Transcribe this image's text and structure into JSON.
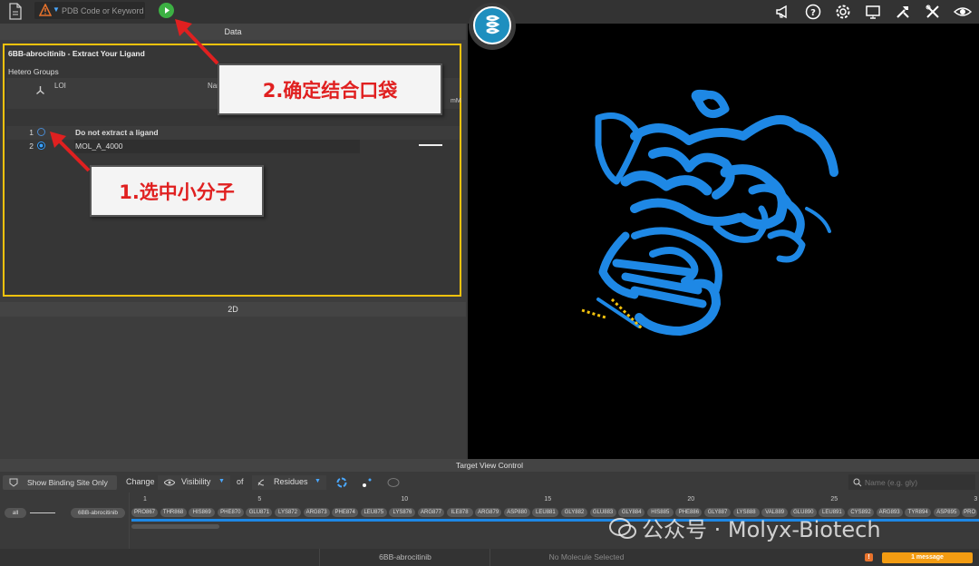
{
  "toolbar": {
    "search_placeholder": "PDB Code or Keyword",
    "icons": [
      "file-icon",
      "warning-icon",
      "play-icon",
      "megaphone-icon",
      "help-icon",
      "settings-icon",
      "monitor-icon",
      "build-tools-icon",
      "tools-icon",
      "eye-icon"
    ]
  },
  "data_panel": {
    "header": "Data",
    "box_title": "6BB-abrocitinib - Extract Your Ligand",
    "section": "Hetero Groups",
    "columns": {
      "loi": "LOI",
      "name": "Name",
      "unit": "mM"
    },
    "rows": [
      {
        "num": "1",
        "name": "Do not extract a ligand",
        "selected": false
      },
      {
        "num": "2",
        "name": "MOL_A_4000",
        "selected": true
      }
    ]
  },
  "panel_2d": {
    "header": "2D"
  },
  "annotations": {
    "step1": "1.选中小分子",
    "step2": "2.确定结合口袋"
  },
  "target_view": {
    "header": "Target View Control",
    "show_binding": "Show Binding Site Only",
    "change": "Change",
    "visibility": "Visibility",
    "of": "of",
    "residues": "Residues",
    "search_placeholder": "Name (e.g. gly)"
  },
  "sequence": {
    "all_label": "all",
    "chain_label": "6BB-abrocitinib",
    "ticks": [
      "1",
      "5",
      "10",
      "15",
      "20",
      "25",
      "3"
    ],
    "residues": [
      "PRO867",
      "THR868",
      "HIS869",
      "PHE870",
      "GLU871",
      "LYS872",
      "ARG873",
      "PHE874",
      "LEU875",
      "LYS876",
      "ARG877",
      "ILE878",
      "ARG879",
      "ASP880",
      "LEU881",
      "GLY882",
      "GLU883",
      "GLY884",
      "HIS885",
      "PHE886",
      "GLY887",
      "LYS888",
      "VAL889",
      "GLU890",
      "LEU891",
      "CYS892",
      "ARG893",
      "TYR894",
      "ASP895",
      "PRO"
    ]
  },
  "status_bar": {
    "molecule": "6BB-abrocitinib",
    "selection": "No Molecule Selected",
    "warn_count": "!",
    "messages": "1 message"
  },
  "watermark": "公众号 · Molyx-Biotech",
  "colors": {
    "accent": "#f4c20d",
    "protein": "#1e88e5",
    "callout_text": "#e02020"
  }
}
